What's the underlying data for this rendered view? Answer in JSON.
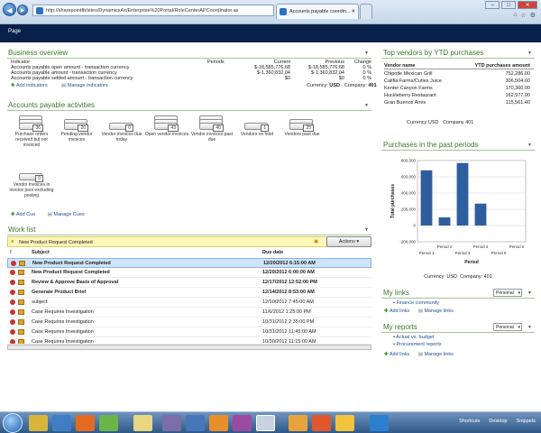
{
  "browser": {
    "address": "http://sharepointfb/sites/DynamicsAx/Enterprise%20Portal/RoleCenterAPCoordinator.as",
    "tab_title": "Accounts payable coordin...",
    "close_label": "✕"
  },
  "appbar": {
    "page_menu": "Page"
  },
  "business": {
    "title": "Business overview",
    "headers": [
      "Indicator",
      "Periods",
      "Current",
      "Previous",
      "Change"
    ],
    "rows": [
      {
        "indicator": "Accounts payable open amount - transaction currency",
        "current": "$-18,585,776.68",
        "previous": "$-18,585,776.68",
        "change": "0 %"
      },
      {
        "indicator": "Accounts payable amount - transaction currency",
        "current": "$-1,360,832.04",
        "previous": "$-1,360,832.04",
        "change": "0 %"
      },
      {
        "indicator": "Accounts payable settled amount - transaction currency",
        "current": "$0",
        "previous": "$0",
        "change": "0 %"
      }
    ],
    "add_label": "Add indicators",
    "manage_label": "Manage indicators",
    "currency_label": "Currency:",
    "currency_value": "USD",
    "company_label": "Company:",
    "company_value": "401"
  },
  "ap_activities": {
    "title": "Accounts payable activities",
    "tiles": [
      {
        "label": "Purchase orders received but not invoiced",
        "count": "36"
      },
      {
        "label": "Pending vendor invoices",
        "count": "20"
      },
      {
        "label": "Vendor invoices due today",
        "count": "0"
      },
      {
        "label": "Open vendor invoices",
        "count": "43"
      },
      {
        "label": "Vendor invoices past due",
        "count": "40"
      },
      {
        "label": "Vendors on hold",
        "count": "1"
      },
      {
        "label": "Vendors past due",
        "count": "25"
      },
      {
        "label": "Vendor invoices in invoice pool excluding posting",
        "count": "0"
      }
    ],
    "add_label": "Add Cue",
    "manage_label": "Manage Cues"
  },
  "work_list": {
    "title": "Work list",
    "banner": "New Product Request Completed",
    "actions_label": "Actions ▾",
    "headers": {
      "flag": "!",
      "subject": "Subject",
      "due": "Due date"
    },
    "rows": [
      {
        "subject": "New Product Request Completed",
        "due": "12/20/2012 6:15:00 AM",
        "bold": true,
        "selected": true
      },
      {
        "subject": "New Product Request Completed",
        "due": "12/20/2012 6:00:00 AM",
        "bold": true,
        "selected": false
      },
      {
        "subject": "Review & Approve Basis of Approval",
        "due": "12/17/2012 12:52:00 PM",
        "bold": true,
        "selected": false
      },
      {
        "subject": "Generate Product Brief",
        "due": "12/14/2012 8:53:00 AM",
        "bold": true,
        "selected": false
      },
      {
        "subject": "subject",
        "due": "12/10/2012 7:45:00 AM",
        "bold": false,
        "selected": false
      },
      {
        "subject": "Case Requires Investigation",
        "due": "11/6/2012 1:25:00 PM",
        "bold": false,
        "selected": false
      },
      {
        "subject": "Case Requires Investigation",
        "due": "10/31/2012 2:35:00 PM",
        "bold": false,
        "selected": false
      },
      {
        "subject": "Case Requires Investigation",
        "due": "10/31/2012 11:45:00 AM",
        "bold": false,
        "selected": false
      },
      {
        "subject": "Case Requires Investigation",
        "due": "10/30/2012 11:15:00 AM",
        "bold": false,
        "selected": false
      }
    ]
  },
  "top_vendors": {
    "title": "Top vendors by YTD purchases",
    "headers": [
      "Vendor name",
      "YTD purchases amount"
    ],
    "rows": [
      {
        "name": "Chipotle Mexican Grill",
        "amount": "752,286.00"
      },
      {
        "name": "Califia Farms/Cuties Juice",
        "amount": "306,504.60"
      },
      {
        "name": "Kenter Canyon Farms",
        "amount": "170,360.00"
      },
      {
        "name": "Huckleberry Restaurant",
        "amount": "162,977.00"
      },
      {
        "name": "Gran Buenos Aires",
        "amount": "115,561.40"
      }
    ],
    "currency_label": "Currency",
    "currency_value": "USD",
    "company_label": "Company",
    "company_value": "401"
  },
  "purchases": {
    "title": "Purchases in the past periods",
    "currency_label": "Currency:",
    "currency_value": "USD",
    "company_label": "Company:",
    "company_value": "401"
  },
  "chart_data": {
    "type": "bar",
    "categories": [
      "Period 1",
      "Period 2",
      "Period 3",
      "Period 4",
      "Period 5",
      "Period 6"
    ],
    "values": [
      680000,
      100000,
      770000,
      270000,
      0,
      0
    ],
    "ylim": [
      -200000,
      800000
    ],
    "yticks": [
      "800,000",
      "600,000",
      "400,000",
      "200,000",
      "0",
      "-200,000"
    ],
    "ylabel": "Total purchases",
    "xlabel": "Period",
    "bar_color": "#2f5e9e",
    "grid": true
  },
  "my_links": {
    "title": "My links",
    "selector": "Personal",
    "items": [
      "Finance community"
    ],
    "add_label": "Add links",
    "manage_label": "Manage links"
  },
  "my_reports": {
    "title": "My reports",
    "selector": "Personal",
    "items": [
      "Actual vs. budget",
      "Procurement reports"
    ],
    "add_label": "Add links",
    "manage_label": "Manage links"
  },
  "taskbar": {
    "shortcuts": "Shortcuts",
    "desktop": "Desktop",
    "snippets": "Snippets"
  },
  "colors": {
    "section_title": "#3b7a2a",
    "nav_bar": "#08204a",
    "link": "#1f4f91"
  }
}
